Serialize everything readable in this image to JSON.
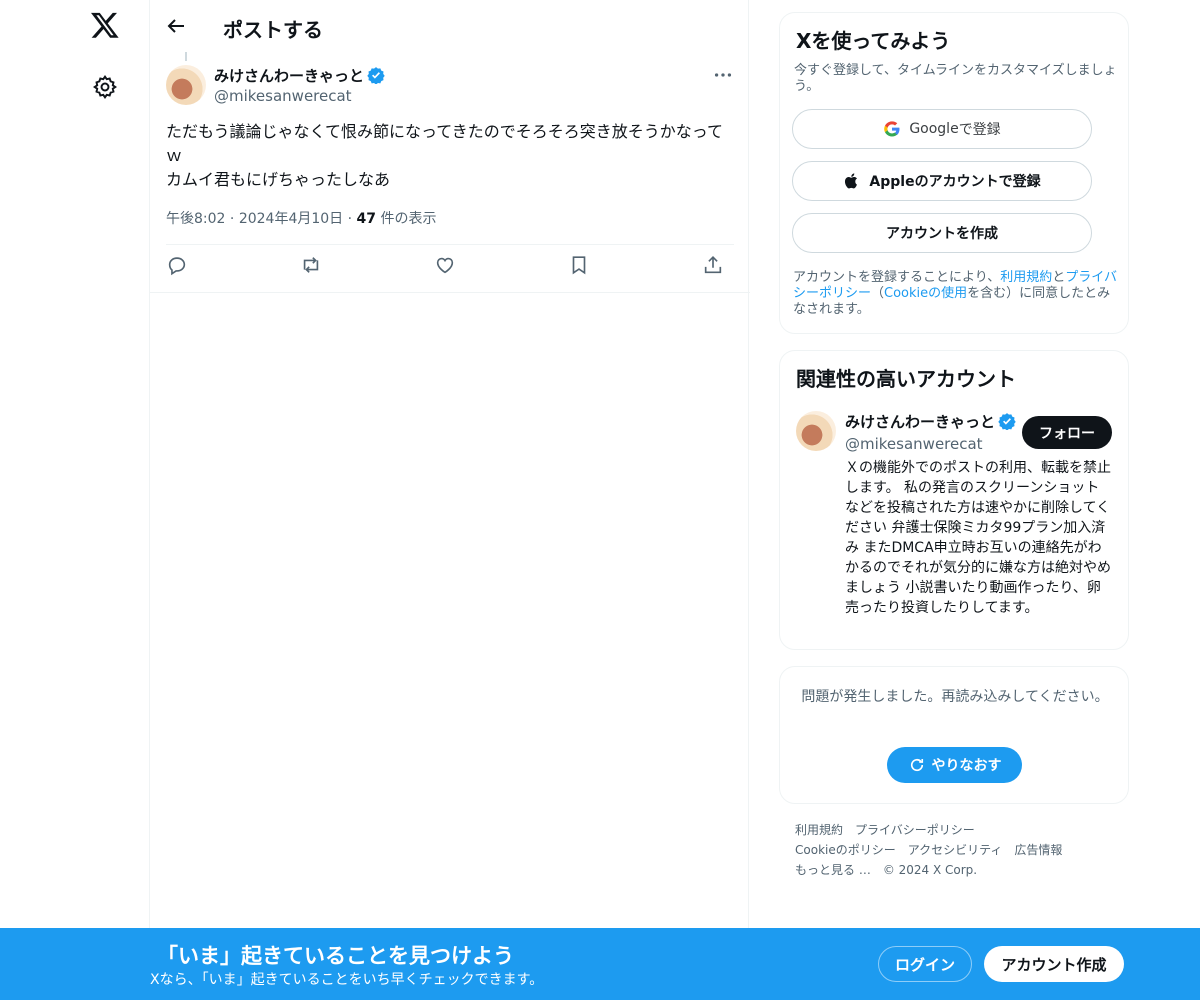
{
  "nav": {
    "logo_icon": "x-logo-icon",
    "settings_icon": "gear-icon"
  },
  "header": {
    "title": "ポストする"
  },
  "post": {
    "author_name": "みけさんわーきゃっと",
    "author_handle": "@mikesanwerecat",
    "text": "ただもう議論じゃなくて恨み節になってきたのでそろそろ突き放そうかなってｗ\nカムイ君もにげちゃったしなあ",
    "time": "午後8:02",
    "date": "2024年4月10日",
    "views_count": "47",
    "views_label": " 件の表示",
    "separator": " · "
  },
  "signup_card": {
    "title": "Xを使ってみよう",
    "subtitle": "今すぐ登録して、タイムラインをカスタマイズしましょう。",
    "google_label": "Google",
    "google_suffix": " で登録",
    "apple_label": "Appleのアカウントで登録",
    "create_label": "アカウントを作成",
    "terms_pre": "アカウントを登録することにより、",
    "terms_link1": "利用規約",
    "terms_mid1": "と",
    "terms_link2": "プライバシーポリシー",
    "terms_mid2": "（",
    "terms_link3": "Cookieの使用",
    "terms_post": "を含む）に同意したとみなされます。"
  },
  "related": {
    "title": "関連性の高いアカウント",
    "name": "みけさんわーきゃっと",
    "handle": "@mikesanwerecat",
    "follow_label": "フォロー",
    "bio": "Ｘの機能外でのポストの利用、転載を禁止します。 私の発言のスクリーンショットなどを投稿された方は速やかに削除してください 弁護士保険ミカタ99プラン加入済み またDMCA申立時お互いの連絡先がわかるのでそれが気分的に嫌な方は絶対やめましょう 小説書いたり動画作ったり、卵売ったり投資したりしてます。"
  },
  "error_card": {
    "message": "問題が発生しました。再読み込みしてください。",
    "retry_label": "やりなおす"
  },
  "footer": {
    "links": [
      "利用規約",
      "プライバシーポリシー",
      "Cookieのポリシー",
      "アクセシビリティ",
      "広告情報",
      "もっと見る …",
      "© 2024 X Corp."
    ]
  },
  "bottom_bar": {
    "title": "「いま」起きていることを見つけよう",
    "subtitle": "Xなら、「いま」起きていることをいち早くチェックできます。",
    "login_label": "ログイン",
    "signup_label": "アカウント作成"
  },
  "colors": {
    "accent": "#1d9bf0",
    "text": "#0f1419",
    "muted": "#536471",
    "border": "#eff3f4"
  }
}
